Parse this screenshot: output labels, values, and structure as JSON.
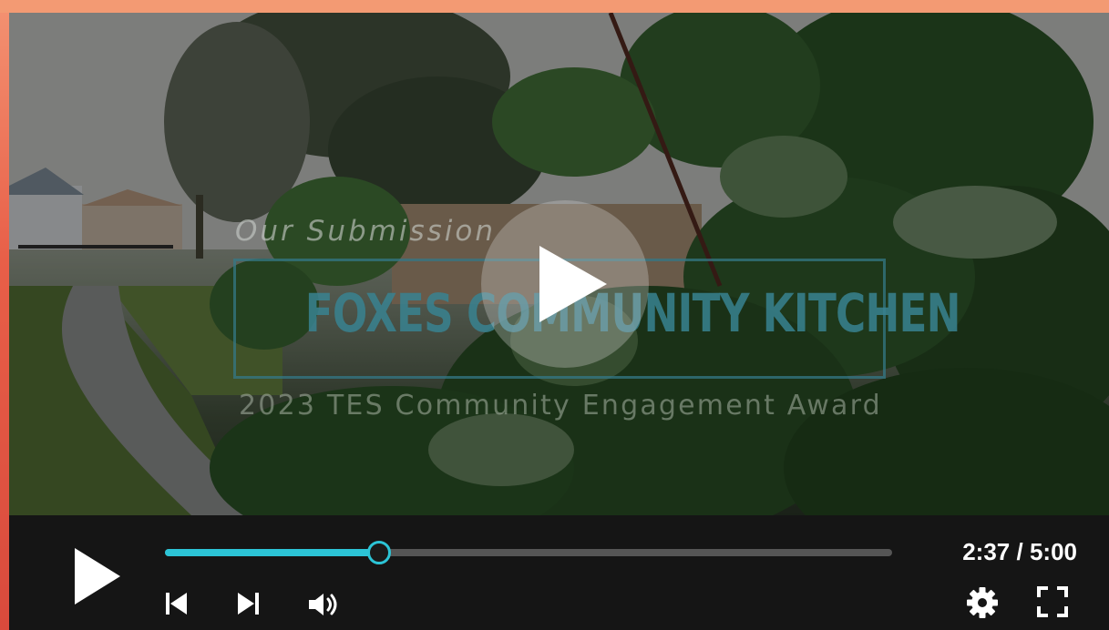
{
  "video": {
    "overlay_subtitle": "Our Submission",
    "overlay_title": "FOXES COMMUNITY KITCHEN",
    "overlay_award": "2023 TES Community Engagement Award"
  },
  "controls": {
    "current_time": "2:37",
    "separator": "/",
    "duration": "5:00",
    "progress": 0.295
  },
  "icons": {
    "big_play": "play-icon",
    "play": "play-icon",
    "previous": "skip-previous-icon",
    "next": "skip-next-icon",
    "volume": "volume-icon",
    "settings": "gear-icon",
    "fullscreen": "fullscreen-icon"
  },
  "colors": {
    "accent": "#2cc4d6",
    "control_bar": "#151515",
    "page_background": "#f08a66"
  }
}
